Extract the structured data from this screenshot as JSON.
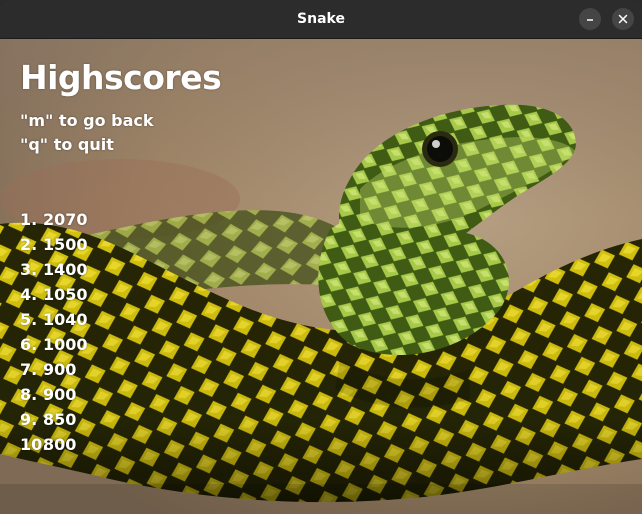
{
  "window": {
    "title": "Snake"
  },
  "heading": "Highscores",
  "instructions": [
    "\"m\" to go back",
    "\"q\" to quit"
  ],
  "scores": [
    {
      "rank": "1.",
      "score": "2070"
    },
    {
      "rank": "2.",
      "score": "1500"
    },
    {
      "rank": "3.",
      "score": "1400"
    },
    {
      "rank": "4.",
      "score": "1050"
    },
    {
      "rank": "5.",
      "score": "1040"
    },
    {
      "rank": "6.",
      "score": "1000"
    },
    {
      "rank": "7.",
      "score": "900"
    },
    {
      "rank": "8.",
      "score": "900"
    },
    {
      "rank": "9.",
      "score": "850"
    },
    {
      "rank": "10.",
      "score": "800"
    }
  ],
  "icons": {
    "minimize": "minimize-icon",
    "close": "close-icon",
    "background": "snake-photo"
  },
  "colors": {
    "titlebar": "#2c2c2c",
    "text": "#ffffff",
    "snake_yellow": "#d4c31a",
    "snake_green": "#a6c34a",
    "background_tan": "#a88e72"
  }
}
